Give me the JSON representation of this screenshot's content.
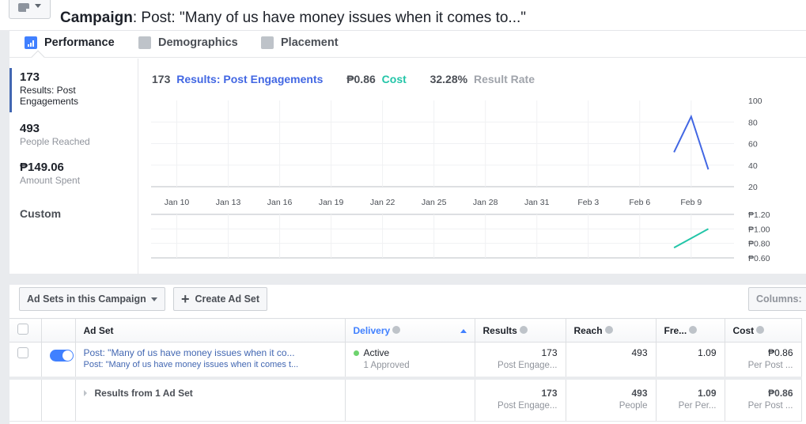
{
  "header": {
    "view_button_icon": "document-icon",
    "campaign_label": "Campaign",
    "campaign_name": ": Post: \"Many of us have money issues when it comes to...\""
  },
  "tabs": [
    {
      "label": "Performance",
      "icon": "bar-chart-icon",
      "active": true
    },
    {
      "label": "Demographics",
      "icon": "people-icon",
      "active": false
    },
    {
      "label": "Placement",
      "icon": "placement-icon",
      "active": false
    }
  ],
  "metrics": [
    {
      "value": "173",
      "label": "Results: Post Engagements",
      "active": true
    },
    {
      "value": "493",
      "label": "People Reached",
      "active": false
    },
    {
      "value": "₱149.06",
      "label": "Amount Spent",
      "active": false
    },
    {
      "value": "Custom",
      "label": "",
      "active": false
    }
  ],
  "chart_header": {
    "results_value": "173",
    "results_label": "Results: Post Engagements",
    "cost_value": "₱0.86",
    "cost_label": "Cost",
    "rate_value": "32.28%",
    "rate_label": "Result Rate"
  },
  "colors": {
    "results_line": "#4267e3",
    "cost_line": "#23c5a8",
    "toggle_on": "#4080ff",
    "active_status": "#6ed36e",
    "accent": "#4267b2"
  },
  "chart_data": [
    {
      "type": "line",
      "title": "Results: Post Engagements",
      "x_ticks": [
        "Jan 10",
        "Jan 13",
        "Jan 16",
        "Jan 19",
        "Jan 22",
        "Jan 25",
        "Jan 28",
        "Jan 31",
        "Feb 3",
        "Feb 6",
        "Feb 9"
      ],
      "x_range_days": [
        -1.5,
        32.5
      ],
      "x_day_index_of_ticks": [
        0,
        3,
        6,
        9,
        12,
        15,
        18,
        21,
        24,
        27,
        30
      ],
      "y_ticks": [
        "100",
        "80",
        "60",
        "40",
        "20"
      ],
      "ylim": [
        20,
        100
      ],
      "grid": true,
      "series": [
        {
          "name": "Results",
          "x": [
            "Feb 8",
            "Feb 9",
            "Feb 10"
          ],
          "x_day_index": [
            29,
            30,
            31
          ],
          "values": [
            52,
            85,
            36
          ]
        }
      ]
    },
    {
      "type": "line",
      "title": "Cost",
      "y_ticks": [
        "₱1.20",
        "₱1.00",
        "₱0.80",
        "₱0.60"
      ],
      "ylim": [
        0.6,
        1.2
      ],
      "grid": true,
      "series": [
        {
          "name": "Cost",
          "x": [
            "Feb 8",
            "Feb 9",
            "Feb 10"
          ],
          "x_day_index": [
            29,
            30,
            31
          ],
          "values": [
            0.74,
            0.87,
            1.0
          ]
        }
      ]
    }
  ],
  "table": {
    "toolbar": {
      "ad_sets_dropdown": "Ad Sets in this Campaign",
      "create_button": "Create Ad Set",
      "columns_button": "Columns:"
    },
    "headers": {
      "ad_set": "Ad Set",
      "delivery": "Delivery",
      "results": "Results",
      "reach": "Reach",
      "frequency": "Fre...",
      "cost": "Cost"
    },
    "rows": [
      {
        "toggle_on": true,
        "name": "Post: \"Many of us have money issues when it co...",
        "sub_name": "Post: \"Many of us have money issues when it comes t...",
        "delivery": "Active",
        "delivery_sub": "1 Approved",
        "results": "173",
        "results_sub": "Post Engage...",
        "reach": "493",
        "frequency": "1.09",
        "cost": "₱0.86",
        "cost_sub": "Per Post ..."
      }
    ],
    "summary": {
      "label": "Results from 1 Ad Set",
      "results": "173",
      "results_sub": "Post Engage...",
      "reach": "493",
      "reach_sub": "People",
      "frequency": "1.09",
      "frequency_sub": "Per Per...",
      "cost": "₱0.86",
      "cost_sub": "Per Post ..."
    }
  }
}
